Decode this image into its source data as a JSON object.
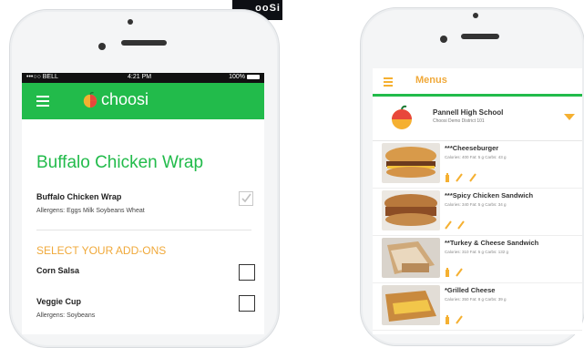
{
  "background_label": "ooSi",
  "screen1": {
    "status": {
      "carrier": "•••○○ BELL",
      "time": "4:21 PM",
      "battery": "100%"
    },
    "brand": "choosi",
    "title": "Buffalo Chicken Wrap",
    "main_item": {
      "name": "Buffalo Chicken Wrap",
      "allergens": "Allergens: Eggs Milk Soybeans Wheat"
    },
    "section_title": "SELECT YOUR ADD-ONS",
    "addons": [
      {
        "name": "Corn Salsa",
        "allergens": ""
      },
      {
        "name": "Veggie Cup",
        "allergens": "Allergens: Soybeans"
      }
    ]
  },
  "screen2": {
    "title": "Menus",
    "school": {
      "name": "Pannell High School",
      "district": "Choosi Demo District 101"
    },
    "items": [
      {
        "name": "***Cheeseburger",
        "nutrition": "Calories: 400  Fat: 5 g  Carbs: 43 g"
      },
      {
        "name": "***Spicy Chicken Sandwich",
        "nutrition": "Calories: 340  Fat: 5 g  Carbs: 34 g"
      },
      {
        "name": "**Turkey & Cheese Sandwich",
        "nutrition": "Calories: 310  Fat: 5 g  Carbs: 132 g"
      },
      {
        "name": "*Grilled Cheese",
        "nutrition": "Calories: 350  Fat: 8 g  Carbs: 39 g"
      }
    ]
  },
  "colors": {
    "green": "#22bb4b",
    "orange": "#f0a93a"
  }
}
